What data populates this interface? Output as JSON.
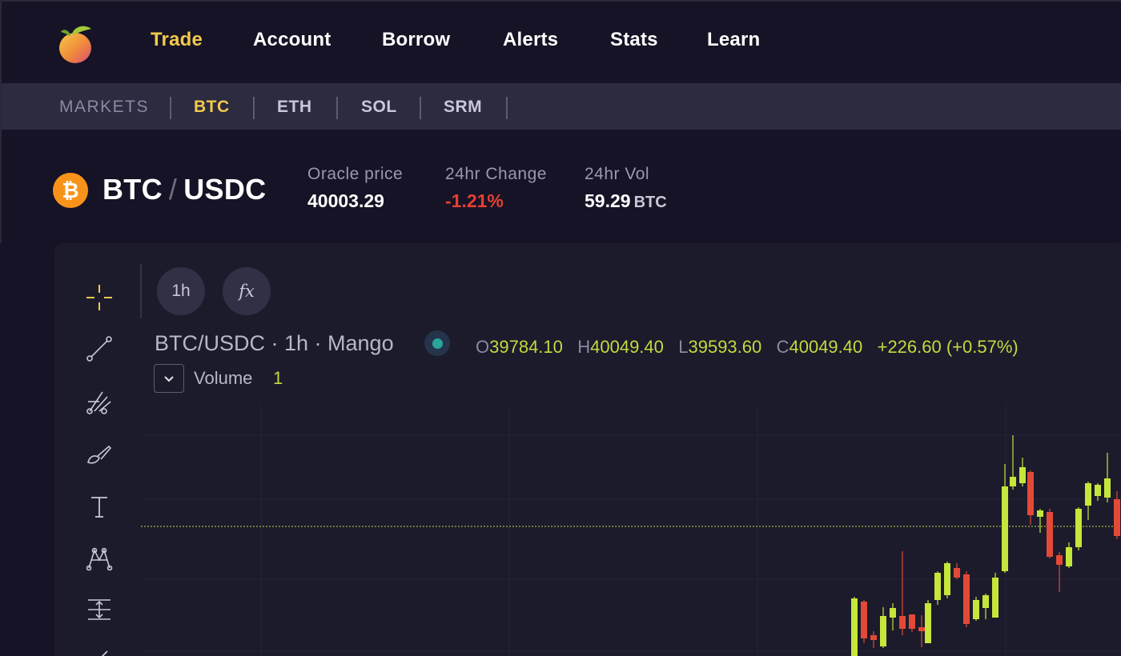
{
  "nav": {
    "items": [
      {
        "label": "Trade",
        "active": true
      },
      {
        "label": "Account",
        "active": false
      },
      {
        "label": "Borrow",
        "active": false
      },
      {
        "label": "Alerts",
        "active": false
      },
      {
        "label": "Stats",
        "active": false
      },
      {
        "label": "Learn",
        "active": false
      }
    ]
  },
  "markets": {
    "label": "MARKETS",
    "items": [
      {
        "label": "BTC",
        "active": true
      },
      {
        "label": "ETH",
        "active": false
      },
      {
        "label": "SOL",
        "active": false
      },
      {
        "label": "SRM",
        "active": false
      }
    ]
  },
  "ticker": {
    "base": "BTC",
    "separator": "/",
    "quote": "USDC",
    "coin_symbol": "₿",
    "oracle_label": "Oracle price",
    "oracle_value": "40003.29",
    "change_label": "24hr Change",
    "change_value": "-1.21%",
    "vol_label": "24hr Vol",
    "vol_value": "59.29",
    "vol_unit": "BTC"
  },
  "chart": {
    "interval_button": "1h",
    "indicator_button": "fx",
    "legend_title": "BTC/USDC · 1h · Mango",
    "ohlc": {
      "o_key": "O",
      "o_val": "39784.10",
      "h_key": "H",
      "h_val": "40049.40",
      "l_key": "L",
      "l_val": "39593.60",
      "c_key": "C",
      "c_val": "40049.40",
      "change": "+226.60 (+0.57%)"
    },
    "volume_label": "Volume",
    "volume_value": "1",
    "colors": {
      "up": "#c5e63a",
      "down": "#e24a37",
      "price_line": "#c5d93f"
    },
    "tools": [
      "crosshair-icon",
      "trend-line-icon",
      "fib-icon",
      "brush-icon",
      "text-icon",
      "pattern-icon",
      "measure-icon",
      "pencil-icon"
    ]
  }
}
